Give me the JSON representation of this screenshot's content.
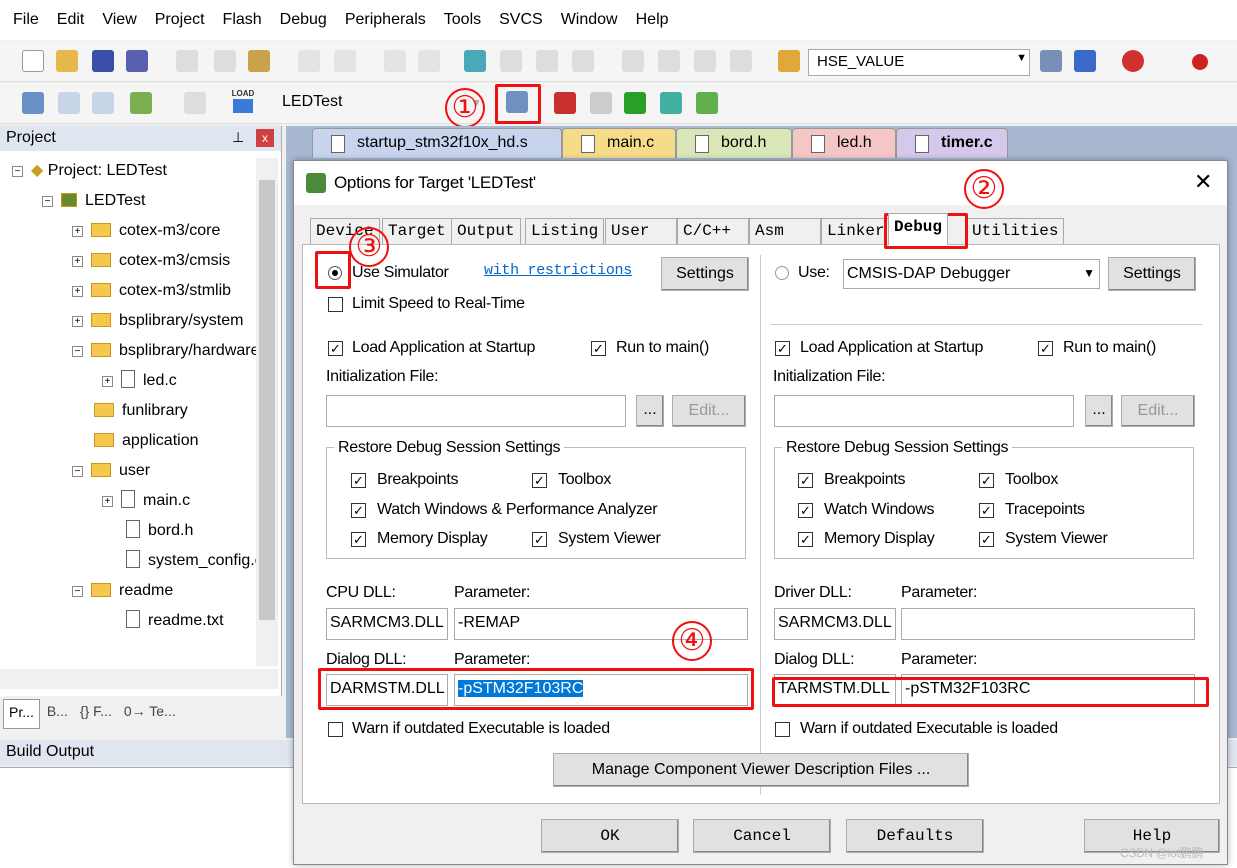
{
  "menu": [
    "File",
    "Edit",
    "View",
    "Project",
    "Flash",
    "Debug",
    "Peripherals",
    "Tools",
    "SVCS",
    "Window",
    "Help"
  ],
  "toolbar": {
    "define_combo": "HSE_VALUE",
    "target_combo": "LEDTest",
    "load_icon_label": "LOAD"
  },
  "project_panel": {
    "title": "Project",
    "tree": [
      {
        "label": "Project: LEDTest",
        "level": 0,
        "type": "project"
      },
      {
        "label": "LEDTest",
        "level": 1,
        "type": "target"
      },
      {
        "label": "cotex-m3/core",
        "level": 2,
        "type": "folder"
      },
      {
        "label": "cotex-m3/cmsis",
        "level": 2,
        "type": "folder"
      },
      {
        "label": "cotex-m3/stmlib",
        "level": 2,
        "type": "folder"
      },
      {
        "label": "bsplibrary/system",
        "level": 2,
        "type": "folder"
      },
      {
        "label": "bsplibrary/hardware",
        "level": 2,
        "type": "folder"
      },
      {
        "label": "led.c",
        "level": 3,
        "type": "file"
      },
      {
        "label": "funlibrary",
        "level": 2,
        "type": "folder"
      },
      {
        "label": "application",
        "level": 2,
        "type": "folder"
      },
      {
        "label": "user",
        "level": 2,
        "type": "folder"
      },
      {
        "label": "main.c",
        "level": 3,
        "type": "file"
      },
      {
        "label": "bord.h",
        "level": 3,
        "type": "file"
      },
      {
        "label": "system_config.c",
        "level": 3,
        "type": "file"
      },
      {
        "label": "readme",
        "level": 2,
        "type": "folder"
      },
      {
        "label": "readme.txt",
        "level": 3,
        "type": "file"
      }
    ],
    "bottom_tabs": [
      "Pr...",
      "B...",
      "{} F...",
      "0→ Te..."
    ]
  },
  "build_output": {
    "title": "Build Output"
  },
  "editor_tabs": [
    {
      "label": "startup_stm32f10x_hd.s",
      "color": "#c8d4ee"
    },
    {
      "label": "main.c",
      "color": "#f6dc8a"
    },
    {
      "label": "bord.h",
      "color": "#d8e6b8"
    },
    {
      "label": "led.h",
      "color": "#f4c6c6"
    },
    {
      "label": "timer.c",
      "color": "#d4c8ec",
      "active": true
    }
  ],
  "dialog": {
    "title": "Options for Target 'LEDTest'",
    "tabs": [
      "Device",
      "Target",
      "Output",
      "Listing",
      "User",
      "C/C++",
      "Asm",
      "Linker",
      "Debug",
      "Utilities"
    ],
    "active_tab": "Debug",
    "left": {
      "use_simulator": "Use Simulator",
      "simulator_selected": true,
      "restrictions_link": "with restrictions",
      "settings": "Settings",
      "limit_speed": "Limit Speed to Real-Time",
      "limit_speed_checked": false,
      "load_app": "Load Application at Startup",
      "run_to_main": "Run to main()",
      "init_file_label": "Initialization File:",
      "init_file": "",
      "browse": "...",
      "edit": "Edit...",
      "restore_group": "Restore Debug Session Settings",
      "breakpoints": "Breakpoints",
      "toolbox": "Toolbox",
      "watch": "Watch Windows & Performance Analyzer",
      "memory": "Memory Display",
      "system_viewer": "System Viewer",
      "cpu_dll_label": "CPU DLL:",
      "cpu_param_label": "Parameter:",
      "cpu_dll": "SARMCM3.DLL",
      "cpu_param": "-REMAP",
      "dialog_dll_label": "Dialog DLL:",
      "dialog_param_label": "Parameter:",
      "dialog_dll": "DARMSTM.DLL",
      "dialog_param": "-pSTM32F103RC",
      "warn": "Warn if outdated Executable is loaded"
    },
    "right": {
      "use": "Use:",
      "debugger": "CMSIS-DAP Debugger",
      "settings": "Settings",
      "load_app": "Load Application at Startup",
      "run_to_main": "Run to main()",
      "init_file_label": "Initialization File:",
      "init_file": "",
      "browse": "...",
      "edit": "Edit...",
      "restore_group": "Restore Debug Session Settings",
      "breakpoints": "Breakpoints",
      "toolbox": "Toolbox",
      "watch": "Watch Windows",
      "tracepoints": "Tracepoints",
      "memory": "Memory Display",
      "system_viewer": "System Viewer",
      "driver_dll_label": "Driver DLL:",
      "driver_param_label": "Parameter:",
      "driver_dll": "SARMCM3.DLL",
      "driver_param": "",
      "dialog_dll_label": "Dialog DLL:",
      "dialog_param_label": "Parameter:",
      "dialog_dll": "TARMSTM.DLL",
      "dialog_param": "-pSTM32F103RC",
      "warn": "Warn if outdated Executable is loaded"
    },
    "manage_button": "Manage Component Viewer Description Files ...",
    "ok": "OK",
    "cancel": "Cancel",
    "defaults": "Defaults",
    "help": "Help"
  },
  "annotations": [
    "①",
    "②",
    "③",
    "④"
  ],
  "watermark": "CSDN @iot鹏鹏",
  "colors": {
    "annotation": "#f01010",
    "selection": "#0078d7",
    "link": "#0066cc"
  }
}
